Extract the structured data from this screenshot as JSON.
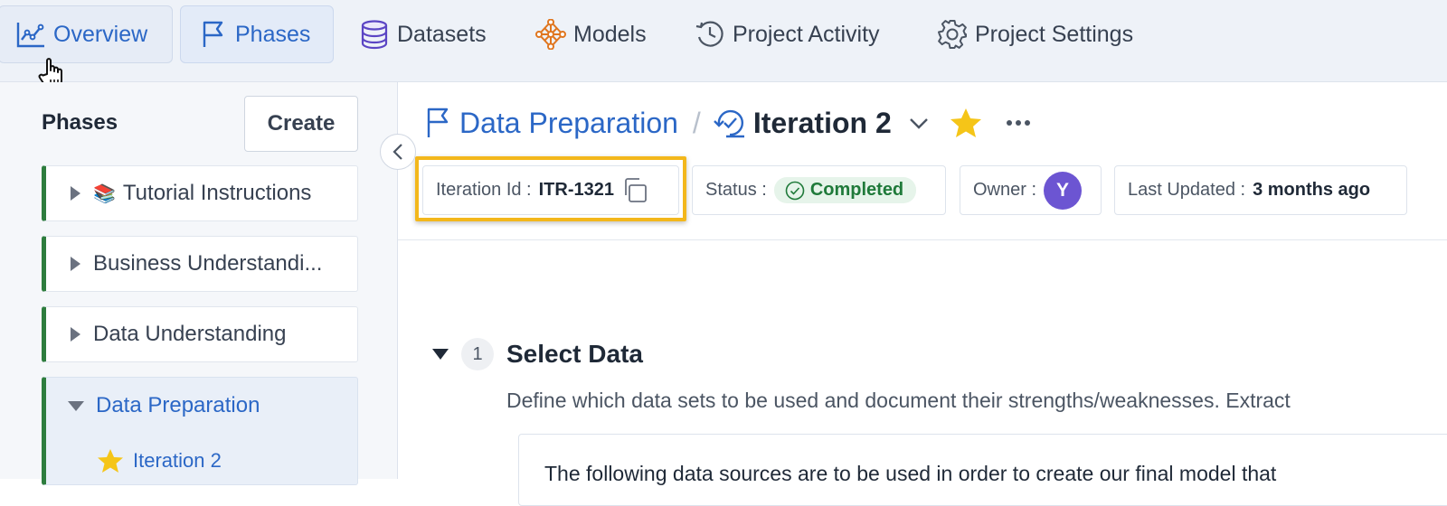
{
  "nav": {
    "tabs": [
      {
        "label": "Overview",
        "icon": "chart-line-icon"
      },
      {
        "label": "Phases",
        "icon": "flag-icon"
      },
      {
        "label": "Datasets",
        "icon": "database-icon"
      },
      {
        "label": "Models",
        "icon": "model-network-icon"
      },
      {
        "label": "Project Activity",
        "icon": "history-icon"
      },
      {
        "label": "Project Settings",
        "icon": "gear-icon"
      }
    ],
    "active_tab": "Phases"
  },
  "sidebar": {
    "title": "Phases",
    "create_label": "Create",
    "items": [
      {
        "label": "Tutorial Instructions",
        "emoji": "📚"
      },
      {
        "label": "Business Understandi..."
      },
      {
        "label": "Data Understanding"
      },
      {
        "label": "Data Preparation",
        "expanded": true,
        "children": [
          {
            "label": "Iteration 2",
            "starred": true
          }
        ]
      }
    ]
  },
  "header": {
    "phase": "Data Preparation",
    "separator": "/",
    "iteration": "Iteration 2"
  },
  "meta": {
    "iteration_id_label": "Iteration Id :",
    "iteration_id": "ITR-1321",
    "status_label": "Status :",
    "status": "Completed",
    "owner_label": "Owner :",
    "owner_initial": "Y",
    "updated_label": "Last Updated :",
    "updated": "3 months ago"
  },
  "section": {
    "number": "1",
    "title": "Select Data",
    "description": "Define which data sets to be used and document their strengths/weaknesses. Extract",
    "body": "The following data sources are to be used in order to create our final model that"
  },
  "colors": {
    "accent": "#2b67c6",
    "phase_bar": "#2e7d3e",
    "highlight": "#f3b71b",
    "status_bg": "#e6f4ea",
    "status_text": "#1f7a3a",
    "avatar": "#6c55d2",
    "star": "#f5c518"
  }
}
